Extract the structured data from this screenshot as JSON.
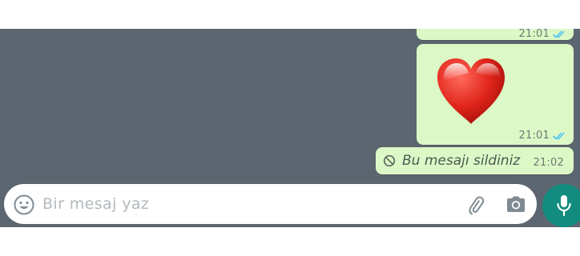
{
  "chat": {
    "messages": [
      {
        "kind": "text-partial",
        "time": "21:01",
        "status": "read"
      },
      {
        "kind": "emoji",
        "emoji": "heart",
        "time": "21:01",
        "status": "read"
      },
      {
        "kind": "deleted",
        "text": "Bu mesajı sildiniz",
        "time": "21:02"
      }
    ]
  },
  "composer": {
    "placeholder": "Bir mesaj yaz"
  },
  "icons": {
    "emoji": "smiley-icon",
    "attach": "paperclip-icon",
    "camera": "camera-icon",
    "mic": "microphone-icon",
    "deleted": "prohibited-icon",
    "ticks": "double-check-icon"
  },
  "colors": {
    "chat_background": "#5c6670",
    "outgoing_bubble": "#dcf8c6",
    "read_ticks": "#4fc3f7",
    "mic_button": "#128c7e",
    "heart": "#e0241a"
  }
}
